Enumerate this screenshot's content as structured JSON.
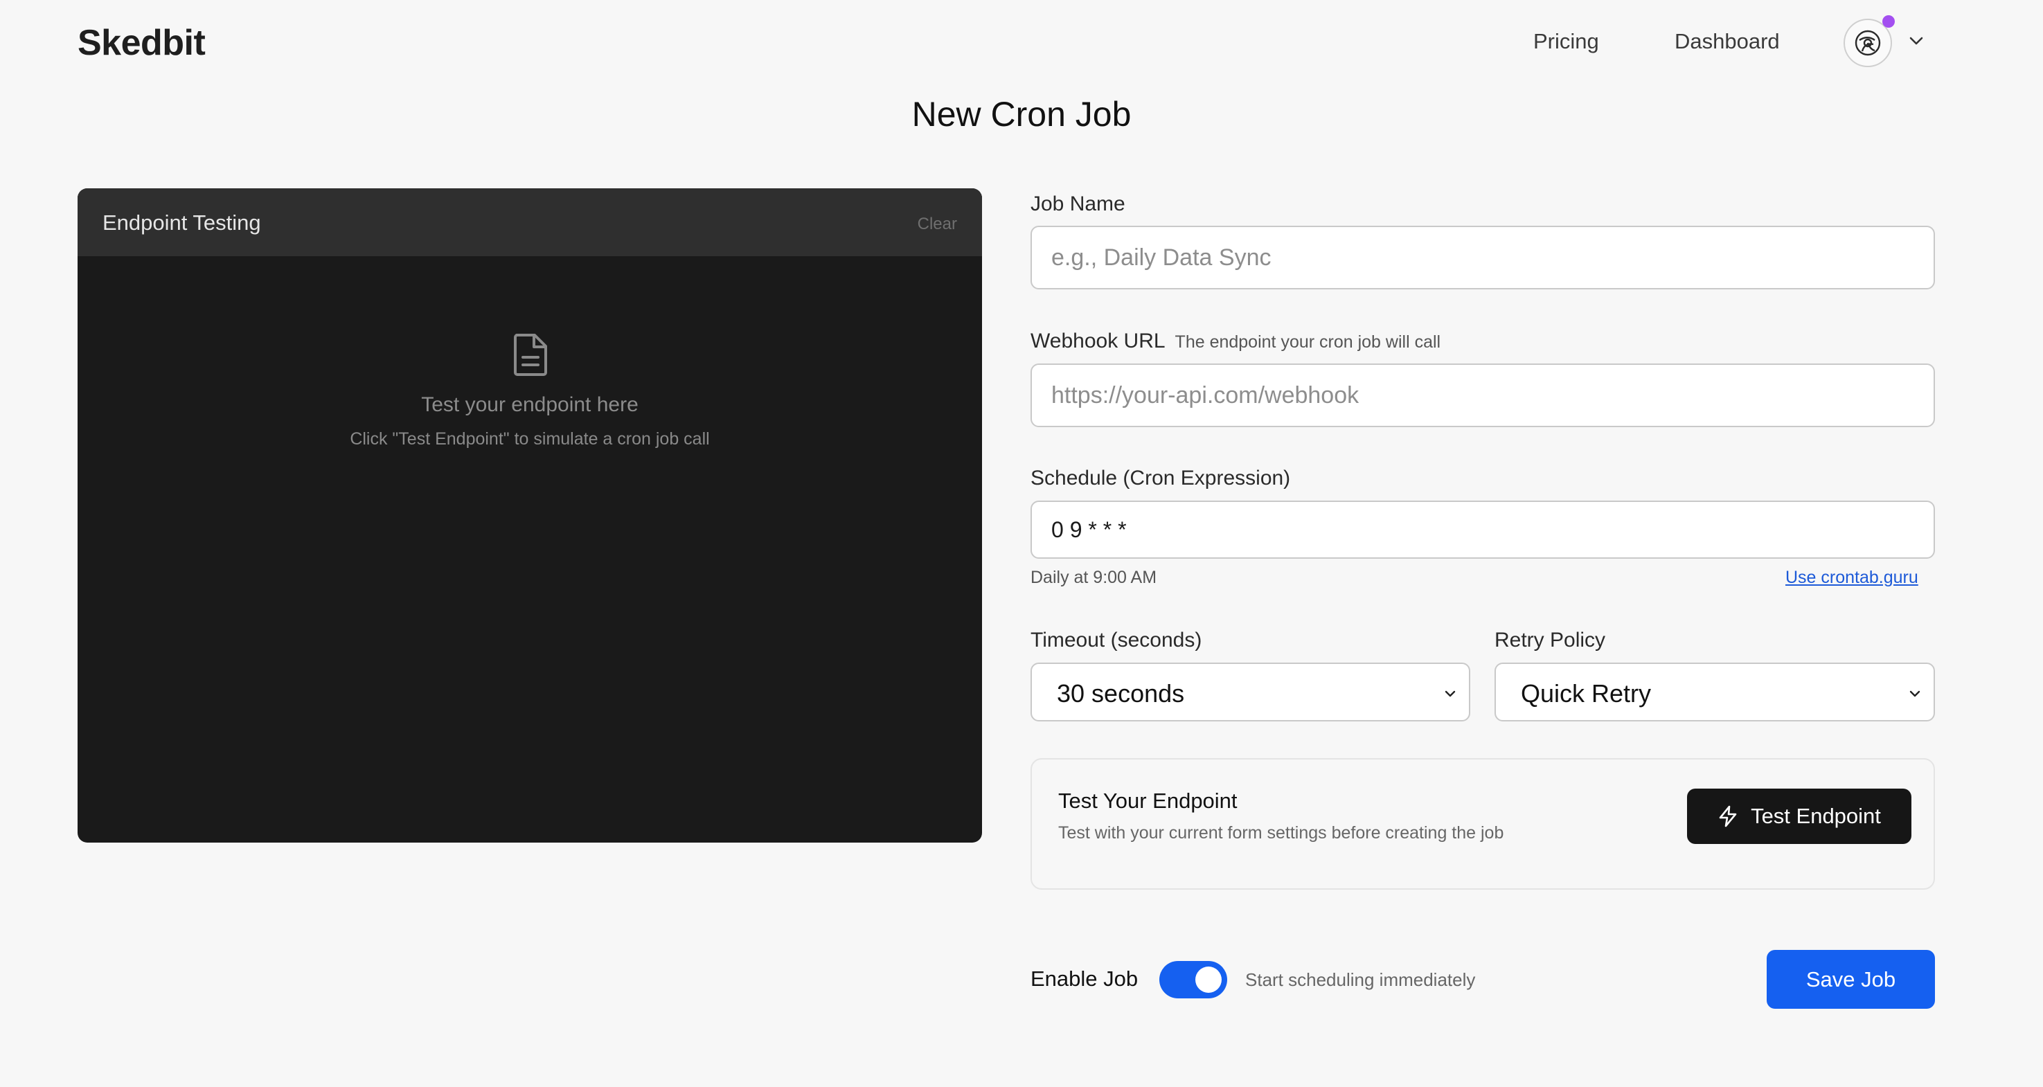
{
  "header": {
    "brand": "Skedbit",
    "nav": {
      "pricing": "Pricing",
      "dashboard": "Dashboard"
    },
    "avatar_icon": "user-avatar-icon",
    "notification_color": "#a34ff0"
  },
  "page": {
    "title": "New Cron Job"
  },
  "endpoint_panel": {
    "title": "Endpoint Testing",
    "clear_label": "Clear",
    "empty_icon": "document-icon",
    "empty_title": "Test your endpoint here",
    "empty_subtitle": "Click \"Test Endpoint\" to simulate a cron job call"
  },
  "form": {
    "job_name": {
      "label": "Job Name",
      "placeholder": "e.g., Daily Data Sync",
      "value": ""
    },
    "webhook_url": {
      "label": "Webhook URL",
      "hint": "The endpoint your cron job will call",
      "placeholder": "https://your-api.com/webhook",
      "value": ""
    },
    "schedule": {
      "label": "Schedule (Cron Expression)",
      "value": "0 9 * * *",
      "description": "Daily at 9:00 AM",
      "help_link": "Use crontab.guru"
    },
    "timeout": {
      "label": "Timeout (seconds)",
      "selected": "30 seconds"
    },
    "retry_policy": {
      "label": "Retry Policy",
      "selected": "Quick Retry"
    }
  },
  "test_card": {
    "title": "Test Your Endpoint",
    "subtitle": "Test with your current form settings before creating the job",
    "button_label": "Test Endpoint",
    "button_icon": "lightning-icon"
  },
  "footer": {
    "enable_label": "Enable Job",
    "enable_hint": "Start scheduling immediately",
    "enabled": true,
    "save_label": "Save Job"
  },
  "colors": {
    "accent": "#1560f0",
    "dark_button": "#161616",
    "panel_bg": "#1a1a1a",
    "panel_header_bg": "#2f2f2f",
    "page_bg": "#f7f7f7"
  }
}
